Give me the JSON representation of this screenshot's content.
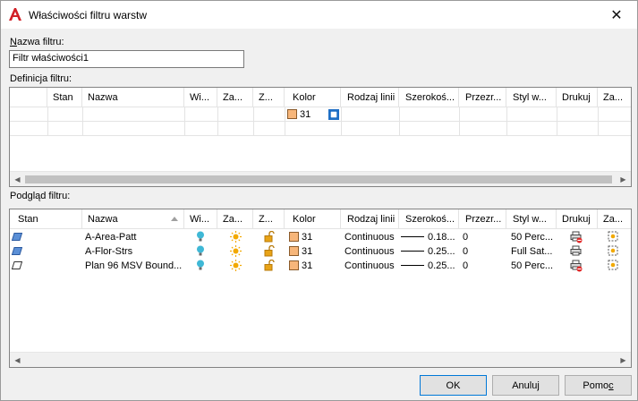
{
  "window": {
    "title": "Właściwości filtru warstw",
    "app_icon": "autocad-a-icon",
    "close_icon": "close-icon"
  },
  "filter_name": {
    "label_prefix": "N",
    "label_rest": "azwa filtru:",
    "value": "Filtr właściwości1"
  },
  "definition": {
    "label": "Definicja filtru:",
    "columns": [
      "",
      "Stan",
      "Nazwa",
      "Wi...",
      "Za...",
      "Z...",
      "Kolor",
      "Rodzaj linii",
      "Szerokoś...",
      "Przezr...",
      "Styl w...",
      "Drukuj",
      "Za..."
    ],
    "row": {
      "color": "31",
      "color_hex": "#f7b67a"
    }
  },
  "preview": {
    "label": "Podgląd filtru:",
    "columns": [
      "Stan",
      "Nazwa",
      "Wi...",
      "Za...",
      "Z...",
      "Kolor",
      "Rodzaj linii",
      "Szerokoś...",
      "Przezr...",
      "Styl w...",
      "Drukuj",
      "Za..."
    ],
    "rows": [
      {
        "name": "A-Area-Patt",
        "color": "31",
        "linetype": "Continuous",
        "lineweight": "0.18...",
        "transparency": "0",
        "plot_style": "50 Perc...",
        "plot_icon": "printer-no-plot-icon"
      },
      {
        "name": "A-Flor-Strs",
        "color": "31",
        "linetype": "Continuous",
        "lineweight": "0.25...",
        "transparency": "0",
        "plot_style": "Full Sat...",
        "plot_icon": "printer-icon"
      },
      {
        "name": "Plan 96 MSV Bound...",
        "color": "31",
        "linetype": "Continuous",
        "lineweight": "0.25...",
        "transparency": "0",
        "plot_style": "50 Perc...",
        "plot_icon": "printer-no-plot-icon"
      }
    ]
  },
  "buttons": {
    "ok": "OK",
    "cancel": "Anuluj",
    "help_prefix": "Pomo",
    "help_underline": "c"
  },
  "colors": {
    "swatch": "#f7b67a",
    "accent": "#0078d7",
    "bulb": "#3fb8d6",
    "sun": "#f2a900",
    "lock": "#e8a317"
  }
}
